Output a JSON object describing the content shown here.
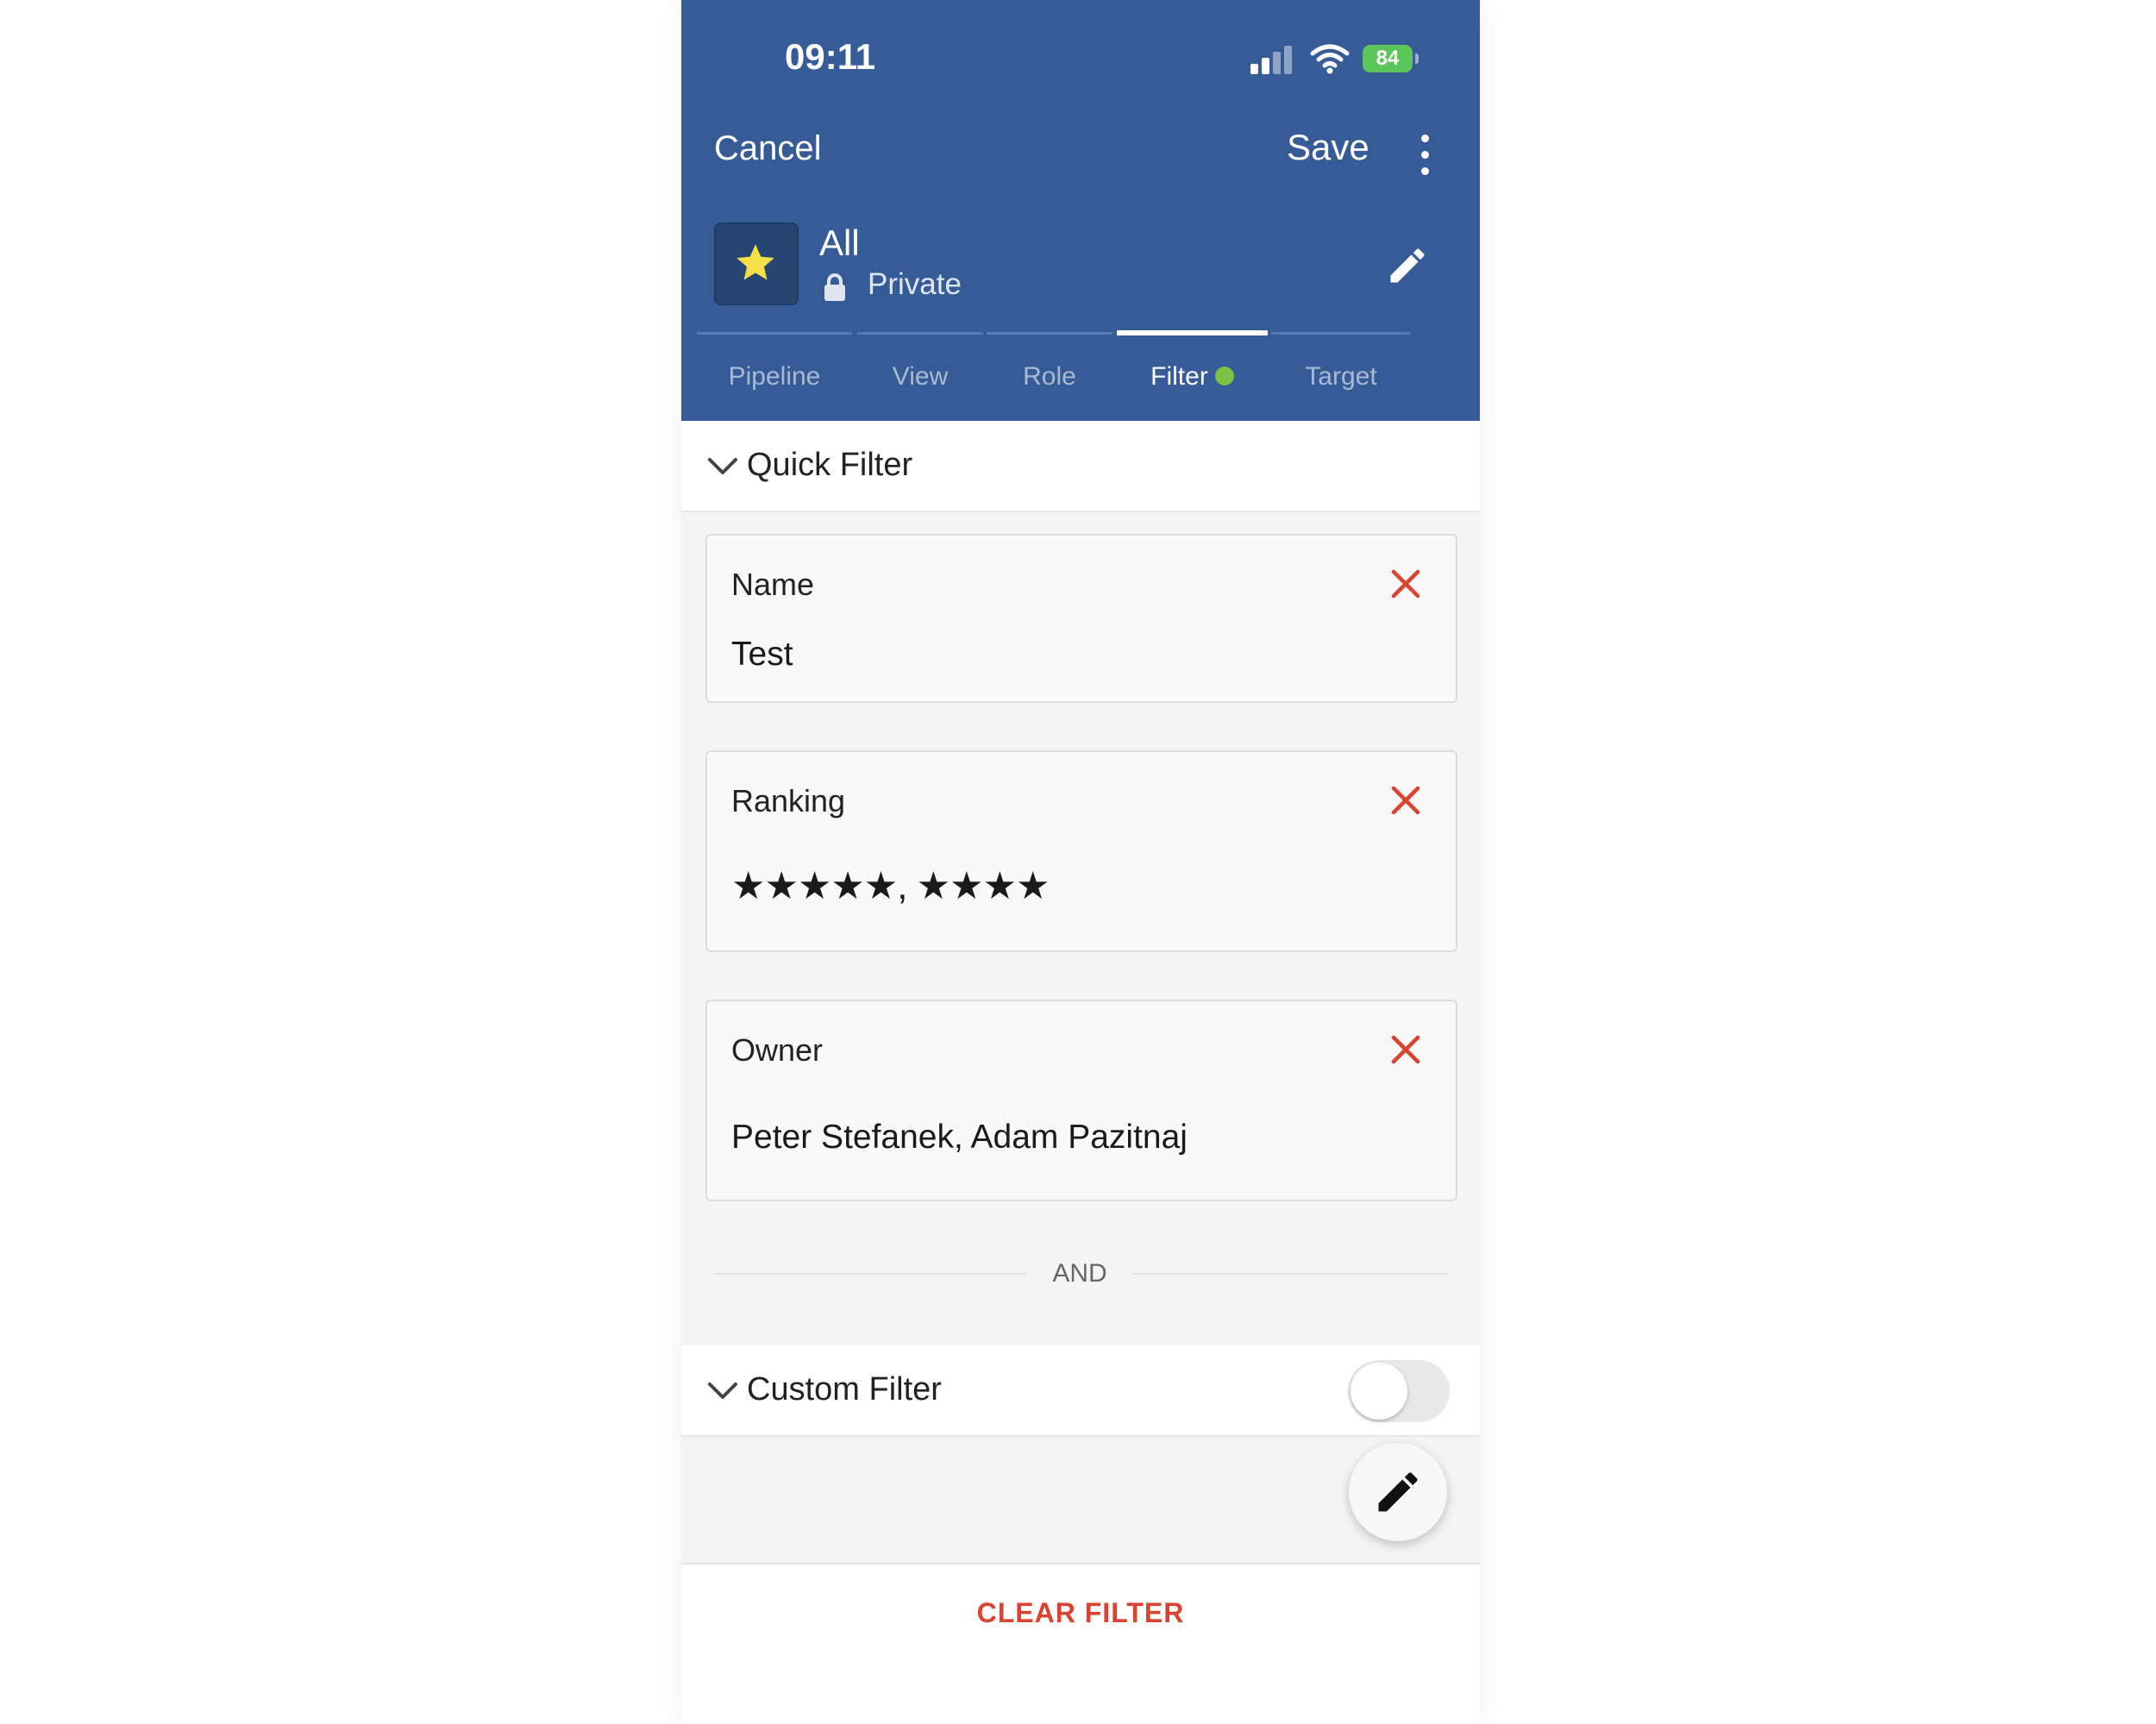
{
  "status_bar": {
    "time": "09:11",
    "battery": "84"
  },
  "nav": {
    "cancel_label": "Cancel",
    "save_label": "Save"
  },
  "list": {
    "title": "All",
    "privacy": "Private"
  },
  "tabs": [
    {
      "label": "Pipeline"
    },
    {
      "label": "View"
    },
    {
      "label": "Role"
    },
    {
      "label": "Filter",
      "active": true
    },
    {
      "label": "Target"
    }
  ],
  "quick_filter": {
    "title": "Quick Filter",
    "items": [
      {
        "label": "Name",
        "value": "Test"
      },
      {
        "label": "Ranking",
        "value": "★★★★★, ★★★★"
      },
      {
        "label": "Owner",
        "value": "Peter Stefanek, Adam Pazitnaj"
      }
    ]
  },
  "operator_label": "AND",
  "custom_filter": {
    "title": "Custom Filter",
    "enabled": false
  },
  "footer": {
    "clear_label": "CLEAR FILTER"
  },
  "colors": {
    "header_bg": "#365b97",
    "accent_star": "#f6e04a",
    "remove_red": "#d9432f",
    "filter_dot": "#7cc243"
  },
  "icons": [
    "star-icon",
    "lock-icon",
    "pencil-icon",
    "more-vertical-icon",
    "chevron-down-icon",
    "close-icon",
    "signal-icon",
    "wifi-icon",
    "battery-icon"
  ]
}
